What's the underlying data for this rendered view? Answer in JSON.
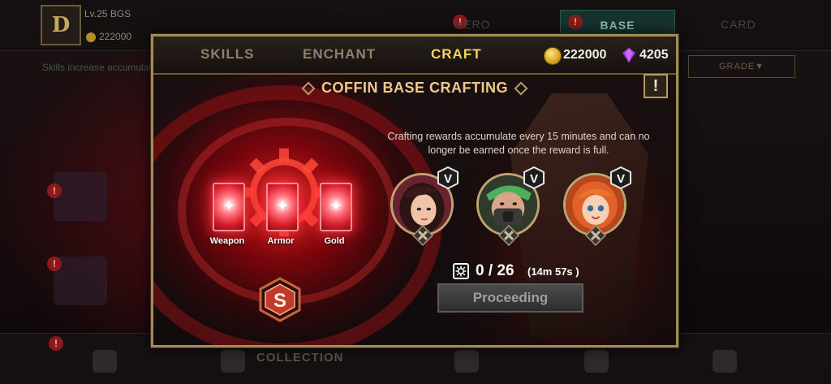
{
  "background": {
    "player_level": "Lv.25",
    "player_name": "BGS",
    "player_gold": "222000",
    "tabs": [
      "HERO",
      "BASE",
      "CARD"
    ],
    "hint": "Skills increase accumulated",
    "grade_filter": "GRADE▼",
    "bottom_collection": "COLLECTION"
  },
  "panel": {
    "tabs": [
      {
        "label": "SKILLS",
        "active": false
      },
      {
        "label": "ENCHANT",
        "active": false
      },
      {
        "label": "CRAFT",
        "active": true
      }
    ],
    "currency": {
      "gold": "222000",
      "gems": "4205",
      "gold_icon": "gold-coin-icon",
      "gem_icon": "purple-gem-icon"
    },
    "title": "COFFIN BASE CRAFTING",
    "info_button": "!",
    "craft_slots": [
      {
        "label": "Weapon"
      },
      {
        "label": "Armor"
      },
      {
        "label": "Gold"
      }
    ],
    "grade_badge": "S",
    "info_text": "Crafting rewards accumulate every 15 minutes and can no longer be earned once the reward is full.",
    "heroes": [
      {
        "name": "hero-dark-hair-woman",
        "rank": "V"
      },
      {
        "name": "hero-masked-soldier",
        "rank": "V"
      },
      {
        "name": "hero-red-hair-girl",
        "rank": "V"
      }
    ],
    "progress": {
      "value": "0 / 26",
      "time": "(14m 57s )"
    },
    "proceed_button": "Proceeding",
    "accent_color": "#f6d461",
    "frame_color": "#a58c57"
  }
}
